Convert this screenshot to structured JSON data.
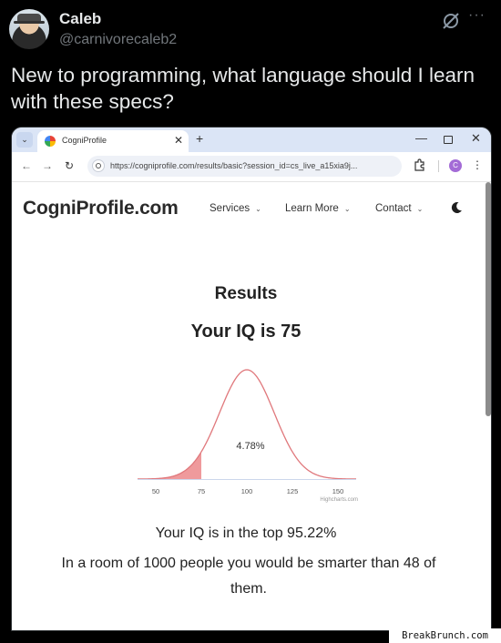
{
  "tweet": {
    "name": "Caleb",
    "handle": "@carnivorecaleb2",
    "more_label": "···",
    "text": "New to programming, what language should I learn with these specs?"
  },
  "browser": {
    "tab_dropdown": "⌄",
    "tab_title": "CogniProfile",
    "tab_close": "✕",
    "new_tab": "+",
    "win_min": "—",
    "win_close": "✕",
    "back": "←",
    "forward": "→",
    "reload": "↻",
    "url": "https://cogniprofile.com/results/basic?session_id=cs_live_a15xia9j...",
    "profile_initial": "C",
    "menu": "⋮"
  },
  "site": {
    "logo": "CogniProfile.com",
    "nav": [
      {
        "label": "Services"
      },
      {
        "label": "Learn More"
      },
      {
        "label": "Contact"
      }
    ],
    "results_title": "Results",
    "iq_title": "Your IQ is 75",
    "top_line": "Your IQ is in the top 95.22%",
    "room_line": "In a room of 1000 people you would be smarter than 48 of them."
  },
  "chart_data": {
    "type": "area",
    "title": "",
    "xlabel": "",
    "ylabel": "",
    "x_ticks": [
      50,
      75,
      100,
      125,
      150
    ],
    "xlim": [
      40,
      160
    ],
    "distribution": {
      "mean": 100,
      "sd": 15
    },
    "shaded_below": 75,
    "annotation": "4.78%",
    "credits": "Highcharts.com",
    "colors": {
      "line": "#e0787c",
      "fill": "#ef9a9c"
    }
  },
  "watermark": "BreakBrunch.com"
}
